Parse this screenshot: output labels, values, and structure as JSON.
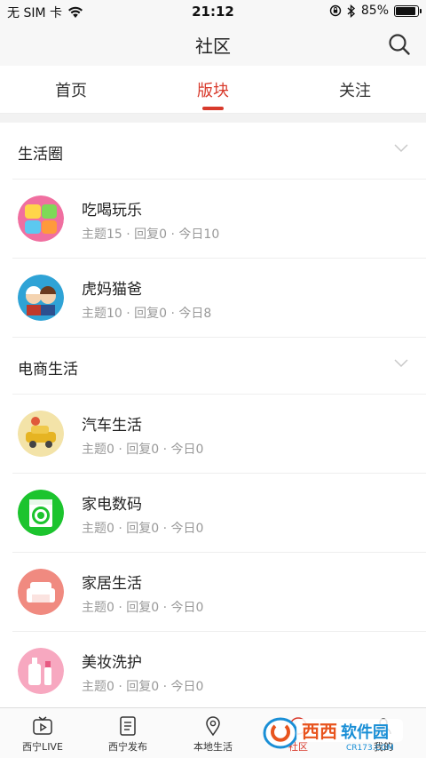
{
  "status": {
    "carrier": "无 SIM 卡",
    "time": "21:12",
    "battery": "85%",
    "battery_level": 0.85
  },
  "nav": {
    "title": "社区",
    "search_icon": "search-icon"
  },
  "tabs": [
    {
      "label": "首页"
    },
    {
      "label": "版块",
      "active": true
    },
    {
      "label": "关注"
    }
  ],
  "sections": [
    {
      "title": "生活圈",
      "items": [
        {
          "title": "吃喝玩乐",
          "meta": "主题15 · 回复0 · 今日10",
          "avatar_color": "#f06fa0"
        },
        {
          "title": "虎妈猫爸",
          "meta": "主题10 · 回复0 · 今日8",
          "avatar_color": "#2fa3d6"
        }
      ]
    },
    {
      "title": "电商生活",
      "items": [
        {
          "title": "汽车生活",
          "meta": "主题0 · 回复0 · 今日0",
          "avatar_color": "#f3e3a8"
        },
        {
          "title": "家电数码",
          "meta": "主题0 · 回复0 · 今日0",
          "avatar_color": "#1cc42e"
        },
        {
          "title": "家居生活",
          "meta": "主题0 · 回复0 · 今日0",
          "avatar_color": "#f08a80"
        },
        {
          "title": "美妆洗护",
          "meta": "主题0 · 回复0 · 今日0",
          "avatar_color": "#f7a8c0"
        }
      ]
    }
  ],
  "bottom_tabs": [
    {
      "label": "西宁LIVE",
      "icon": "tv-icon"
    },
    {
      "label": "西宁发布",
      "icon": "document-icon"
    },
    {
      "label": "本地生活",
      "icon": "location-pin-icon"
    },
    {
      "label": "社区",
      "icon": "community-icon",
      "active": true
    },
    {
      "label": "我的",
      "icon": "profile-icon"
    }
  ],
  "watermark": {
    "text": "西西软件园",
    "sub": "CR173.COM"
  },
  "colors": {
    "accent": "#d83a2c"
  }
}
